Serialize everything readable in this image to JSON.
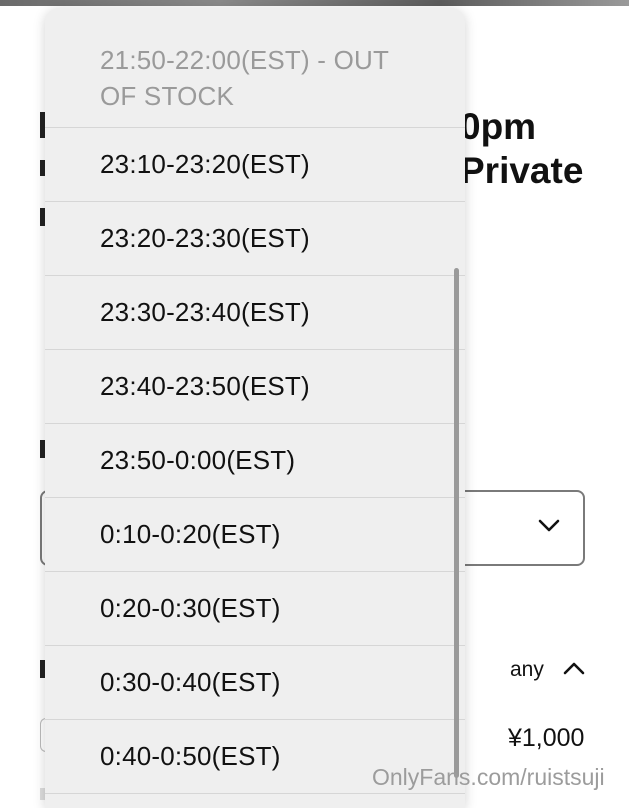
{
  "page": {
    "title_fragment_line1": "0pm",
    "title_fragment_line2": "Private",
    "quantity_label": "any",
    "price": "¥1,000"
  },
  "dropdown": {
    "options": [
      {
        "label": "21:50-22:00(EST) - OUT OF STOCK",
        "disabled": true
      },
      {
        "label": "23:10-23:20(EST)",
        "disabled": false
      },
      {
        "label": "23:20-23:30(EST)",
        "disabled": false
      },
      {
        "label": "23:30-23:40(EST)",
        "disabled": false
      },
      {
        "label": "23:40-23:50(EST)",
        "disabled": false
      },
      {
        "label": "23:50-0:00(EST)",
        "disabled": false
      },
      {
        "label": "0:10-0:20(EST)",
        "disabled": false
      },
      {
        "label": "0:20-0:30(EST)",
        "disabled": false
      },
      {
        "label": "0:30-0:40(EST)",
        "disabled": false
      },
      {
        "label": "0:40-0:50(EST)",
        "disabled": false
      }
    ]
  },
  "watermark": "OnlyFans.com/ruistsuji",
  "icons": {
    "select_chevron": "chevron-down-icon",
    "collapse_chevron": "chevron-up-icon"
  }
}
